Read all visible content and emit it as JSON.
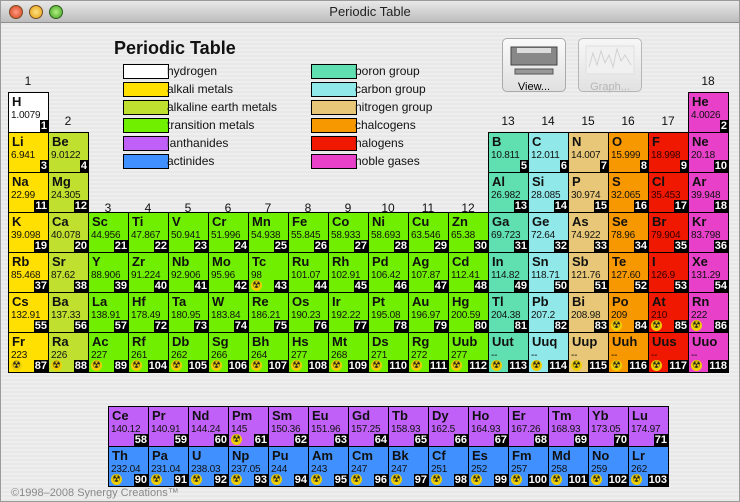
{
  "window": {
    "title": "Periodic Table"
  },
  "header": {
    "title": "Periodic Table"
  },
  "buttons": {
    "view": "View...",
    "graph": "Graph..."
  },
  "copyright": "©1998–2008 Synergy Creations™",
  "legend": [
    {
      "key": "hydrogen",
      "label": "hydrogen",
      "color": "#ffffff"
    },
    {
      "key": "alkali",
      "label": "alkali metals",
      "color": "#ffe000"
    },
    {
      "key": "alkaline",
      "label": "alkaline earth metals",
      "color": "#c0e030"
    },
    {
      "key": "transition",
      "label": "transition metals",
      "color": "#70f000"
    },
    {
      "key": "lanthanide",
      "label": "lanthanides",
      "color": "#c060f8"
    },
    {
      "key": "actinide",
      "label": "actinides",
      "color": "#4090ff"
    },
    {
      "key": "boron",
      "label": "boron group",
      "color": "#60e0b0"
    },
    {
      "key": "carbon",
      "label": "carbon group",
      "color": "#90e8e8"
    },
    {
      "key": "nitrogen",
      "label": "nitrogen group",
      "color": "#e8c878"
    },
    {
      "key": "chalcogen",
      "label": "chalcogens",
      "color": "#f89800"
    },
    {
      "key": "halogen",
      "label": "halogens",
      "color": "#f01800"
    },
    {
      "key": "noble",
      "label": "noble gases",
      "color": "#e840c8"
    }
  ],
  "groups": [
    "1",
    "2",
    "3",
    "4",
    "5",
    "6",
    "7",
    "8",
    "9",
    "10",
    "11",
    "12",
    "13",
    "14",
    "15",
    "16",
    "17",
    "18"
  ],
  "elements": [
    [
      "H",
      "1.0079",
      1
    ],
    [
      "He",
      "4.0026",
      2
    ],
    [
      "Li",
      "6.941",
      3
    ],
    [
      "Be",
      "9.0122",
      4
    ],
    [
      "B",
      "10.811",
      5
    ],
    [
      "C",
      "12.011",
      6
    ],
    [
      "N",
      "14.007",
      7
    ],
    [
      "O",
      "15.999",
      8
    ],
    [
      "F",
      "18.998",
      9
    ],
    [
      "Ne",
      "20.18",
      10
    ],
    [
      "Na",
      "22.99",
      11
    ],
    [
      "Mg",
      "24.305",
      12
    ],
    [
      "Al",
      "26.982",
      13
    ],
    [
      "Si",
      "28.085",
      14
    ],
    [
      "P",
      "30.974",
      15
    ],
    [
      "S",
      "32.065",
      16
    ],
    [
      "Cl",
      "35.453",
      17
    ],
    [
      "Ar",
      "39.948",
      18
    ],
    [
      "K",
      "39.098",
      19
    ],
    [
      "Ca",
      "40.078",
      20
    ],
    [
      "Sc",
      "44.956",
      21
    ],
    [
      "Ti",
      "47.867",
      22
    ],
    [
      "V",
      "50.941",
      23
    ],
    [
      "Cr",
      "51.996",
      24
    ],
    [
      "Mn",
      "54.938",
      25
    ],
    [
      "Fe",
      "55.845",
      26
    ],
    [
      "Co",
      "58.933",
      27
    ],
    [
      "Ni",
      "58.693",
      28
    ],
    [
      "Cu",
      "63.546",
      29
    ],
    [
      "Zn",
      "65.38",
      30
    ],
    [
      "Ga",
      "69.723",
      31
    ],
    [
      "Ge",
      "72.64",
      32
    ],
    [
      "As",
      "74.922",
      33
    ],
    [
      "Se",
      "78.96",
      34
    ],
    [
      "Br",
      "79.904",
      35
    ],
    [
      "Kr",
      "83.798",
      36
    ],
    [
      "Rb",
      "85.468",
      37
    ],
    [
      "Sr",
      "87.62",
      38
    ],
    [
      "Y",
      "88.906",
      39
    ],
    [
      "Zr",
      "91.224",
      40
    ],
    [
      "Nb",
      "92.906",
      41
    ],
    [
      "Mo",
      "95.96",
      42
    ],
    [
      "Tc",
      "98",
      43
    ],
    [
      "Ru",
      "101.07",
      44
    ],
    [
      "Rh",
      "102.91",
      45
    ],
    [
      "Pd",
      "106.42",
      46
    ],
    [
      "Ag",
      "107.87",
      47
    ],
    [
      "Cd",
      "112.41",
      48
    ],
    [
      "In",
      "114.82",
      49
    ],
    [
      "Sn",
      "118.71",
      50
    ],
    [
      "Sb",
      "121.76",
      51
    ],
    [
      "Te",
      "127.60",
      52
    ],
    [
      "I",
      "126.9",
      53
    ],
    [
      "Xe",
      "131.29",
      54
    ],
    [
      "Cs",
      "132.91",
      55
    ],
    [
      "Ba",
      "137.33",
      56
    ],
    [
      "La",
      "138.91",
      57
    ],
    [
      "Ce",
      "140.12",
      58
    ],
    [
      "Pr",
      "140.91",
      59
    ],
    [
      "Nd",
      "144.24",
      60
    ],
    [
      "Pm",
      "145",
      61
    ],
    [
      "Sm",
      "150.36",
      62
    ],
    [
      "Eu",
      "151.96",
      63
    ],
    [
      "Gd",
      "157.25",
      64
    ],
    [
      "Tb",
      "158.93",
      65
    ],
    [
      "Dy",
      "162.5",
      66
    ],
    [
      "Ho",
      "164.93",
      67
    ],
    [
      "Er",
      "167.26",
      68
    ],
    [
      "Tm",
      "168.93",
      69
    ],
    [
      "Yb",
      "173.05",
      70
    ],
    [
      "Lu",
      "174.97",
      71
    ],
    [
      "Hf",
      "178.49",
      72
    ],
    [
      "Ta",
      "180.95",
      73
    ],
    [
      "W",
      "183.84",
      74
    ],
    [
      "Re",
      "186.21",
      75
    ],
    [
      "Os",
      "190.23",
      76
    ],
    [
      "Ir",
      "192.22",
      77
    ],
    [
      "Pt",
      "195.08",
      78
    ],
    [
      "Au",
      "196.97",
      79
    ],
    [
      "Hg",
      "200.59",
      80
    ],
    [
      "Tl",
      "204.38",
      81
    ],
    [
      "Pb",
      "207.2",
      82
    ],
    [
      "Bi",
      "208.98",
      83
    ],
    [
      "Po",
      "209",
      84
    ],
    [
      "At",
      "210",
      85
    ],
    [
      "Rn",
      "222",
      86
    ],
    [
      "Fr",
      "223",
      87
    ],
    [
      "Ra",
      "226",
      88
    ],
    [
      "Ac",
      "227",
      89
    ],
    [
      "Th",
      "232.04",
      90
    ],
    [
      "Pa",
      "231.04",
      91
    ],
    [
      "U",
      "238.03",
      92
    ],
    [
      "Np",
      "237.05",
      93
    ],
    [
      "Pu",
      "244",
      94
    ],
    [
      "Am",
      "243",
      95
    ],
    [
      "Cm",
      "247",
      96
    ],
    [
      "Bk",
      "247",
      97
    ],
    [
      "Cf",
      "251",
      98
    ],
    [
      "Es",
      "252",
      99
    ],
    [
      "Fm",
      "257",
      100
    ],
    [
      "Md",
      "258",
      101
    ],
    [
      "No",
      "259",
      102
    ],
    [
      "Lr",
      "262",
      103
    ],
    [
      "Rf",
      "261",
      104
    ],
    [
      "Db",
      "262",
      105
    ],
    [
      "Sg",
      "266",
      106
    ],
    [
      "Bh",
      "264",
      107
    ],
    [
      "Hs",
      "277",
      108
    ],
    [
      "Mt",
      "268",
      109
    ],
    [
      "Ds",
      "271",
      110
    ],
    [
      "Rg",
      "272",
      111
    ],
    [
      "Uub",
      "277",
      112
    ],
    [
      "Uut",
      "--",
      113
    ],
    [
      "Uuq",
      "--",
      114
    ],
    [
      "Uup",
      "--",
      115
    ],
    [
      "Uuh",
      "--",
      116
    ],
    [
      "Uus",
      "--",
      117
    ],
    [
      "Uuo",
      "--",
      118
    ]
  ],
  "radioactive": [
    43,
    61,
    84,
    85,
    86,
    87,
    88,
    89,
    90,
    91,
    92,
    93,
    94,
    95,
    96,
    97,
    98,
    99,
    100,
    101,
    102,
    103,
    104,
    105,
    106,
    107,
    108,
    109,
    110,
    111,
    112,
    113,
    114,
    115,
    116,
    117,
    118
  ],
  "radioactive_icon": "radiation-icon"
}
